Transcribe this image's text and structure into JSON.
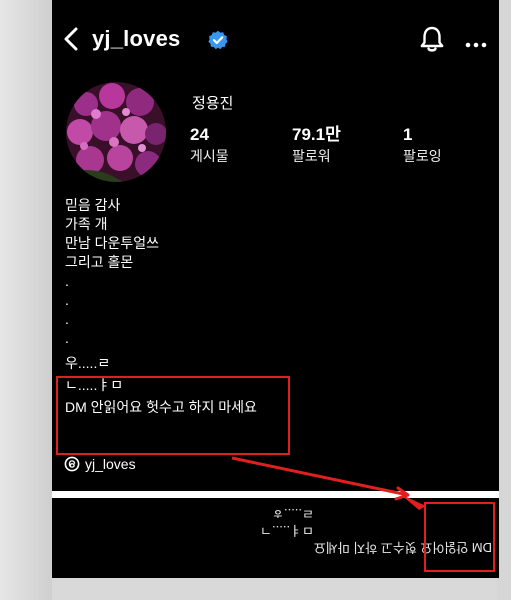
{
  "header": {
    "username": "yj_loves",
    "icons": [
      "back-icon",
      "verified-icon",
      "bell-icon",
      "more-icon"
    ]
  },
  "profile": {
    "display_name": "정용진",
    "stats": {
      "posts": {
        "value": "24",
        "label": "게시물"
      },
      "followers": {
        "value": "79.1만",
        "label": "팔로워"
      },
      "following": {
        "value": "1",
        "label": "팔로잉"
      }
    }
  },
  "bio": {
    "lines": [
      "믿음 감사",
      "가족 개",
      "만남 다운투얼쓰",
      "그리고 홀몬",
      ".",
      ".",
      ".",
      "."
    ],
    "highlighted_lines": [
      "우.....ㄹ",
      "ㄴ.....ㅑㅁ",
      "DM 안읽어요 헛수고 하지 마세요"
    ],
    "threads_handle": "yj_loves"
  },
  "flipped_text": {
    "lines": [
      "DM 안읽어요 헛수고 하지 마세요",
      "ㅁㅕ.....ㄱ",
      "ㄹ.....ㅎ"
    ]
  },
  "colors": {
    "background": "#000000",
    "annotation": "#e01f1f",
    "verified": "#3897f0"
  }
}
